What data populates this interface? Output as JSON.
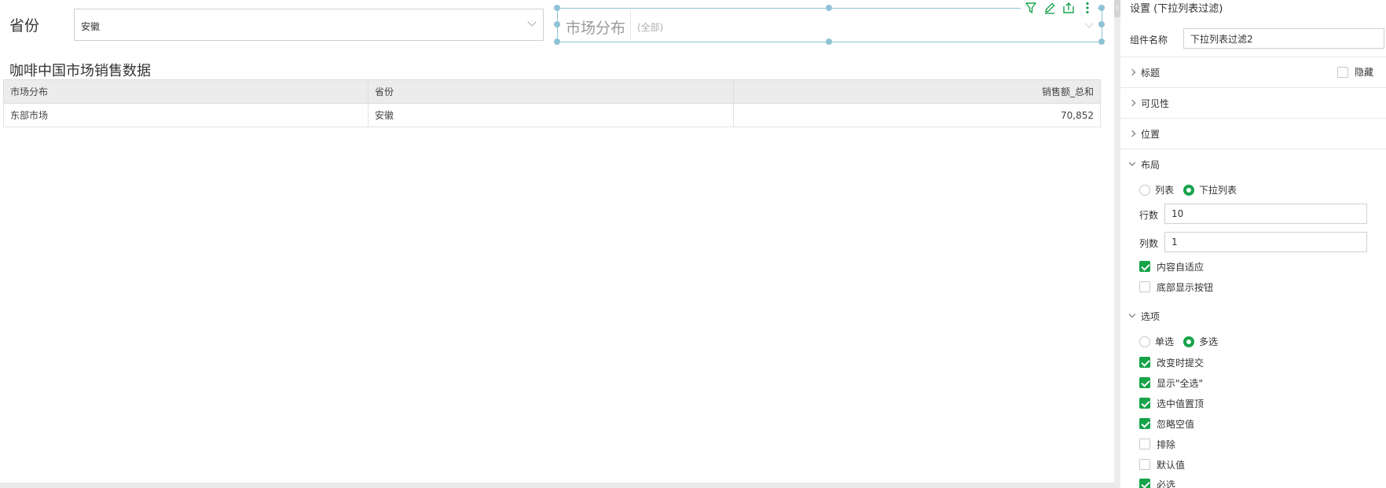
{
  "filters": {
    "province": {
      "label": "省份",
      "value": "安徽"
    },
    "market": {
      "label": "市场分布",
      "value": "(全部)"
    }
  },
  "toolbar_icons": [
    "filter-icon",
    "edit-icon",
    "export-icon",
    "more-icon"
  ],
  "table": {
    "title": "咖啡中国市场销售数据",
    "columns": [
      "市场分布",
      "省份",
      "销售额_总和"
    ],
    "rows": [
      [
        "东部市场",
        "安徽",
        "70,852"
      ]
    ]
  },
  "panel": {
    "header": "设置 (下拉列表过滤)",
    "component_name_label": "组件名称",
    "component_name_value": "下拉列表过滤2",
    "sections": {
      "title": "标题",
      "hide": "隐藏",
      "visibility": "可见性",
      "position": "位置",
      "layout": "布局",
      "options": "选项"
    },
    "layout": {
      "mode_list": "列表",
      "mode_dropdown": "下拉列表",
      "rows_label": "行数",
      "rows_value": "10",
      "cols_label": "列数",
      "cols_value": "1",
      "autofit": "内容自适应",
      "bottom_buttons": "底部显示按钮"
    },
    "options": {
      "single": "单选",
      "multi": "多选",
      "submit_on_change": "改变时提交",
      "show_all": "显示\"全选\"",
      "selected_top": "选中值置顶",
      "ignore_null": "忽略空值",
      "exclude": "排除",
      "default_value": "默认值",
      "required": "必选"
    }
  },
  "colors": {
    "accent": "#16a34a",
    "selection": "#8ec3d6"
  }
}
